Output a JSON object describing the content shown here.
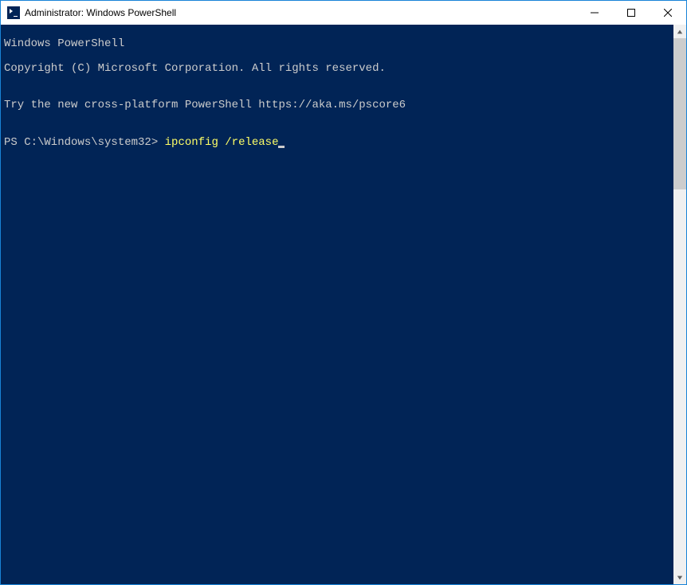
{
  "window": {
    "title": "Administrator: Windows PowerShell"
  },
  "terminal": {
    "line1": "Windows PowerShell",
    "line2": "Copyright (C) Microsoft Corporation. All rights reserved.",
    "line3": "",
    "line4": "Try the new cross-platform PowerShell https://aka.ms/pscore6",
    "line5": "",
    "prompt": "PS C:\\Windows\\system32> ",
    "command": "ipconfig",
    "arg": " /release"
  }
}
